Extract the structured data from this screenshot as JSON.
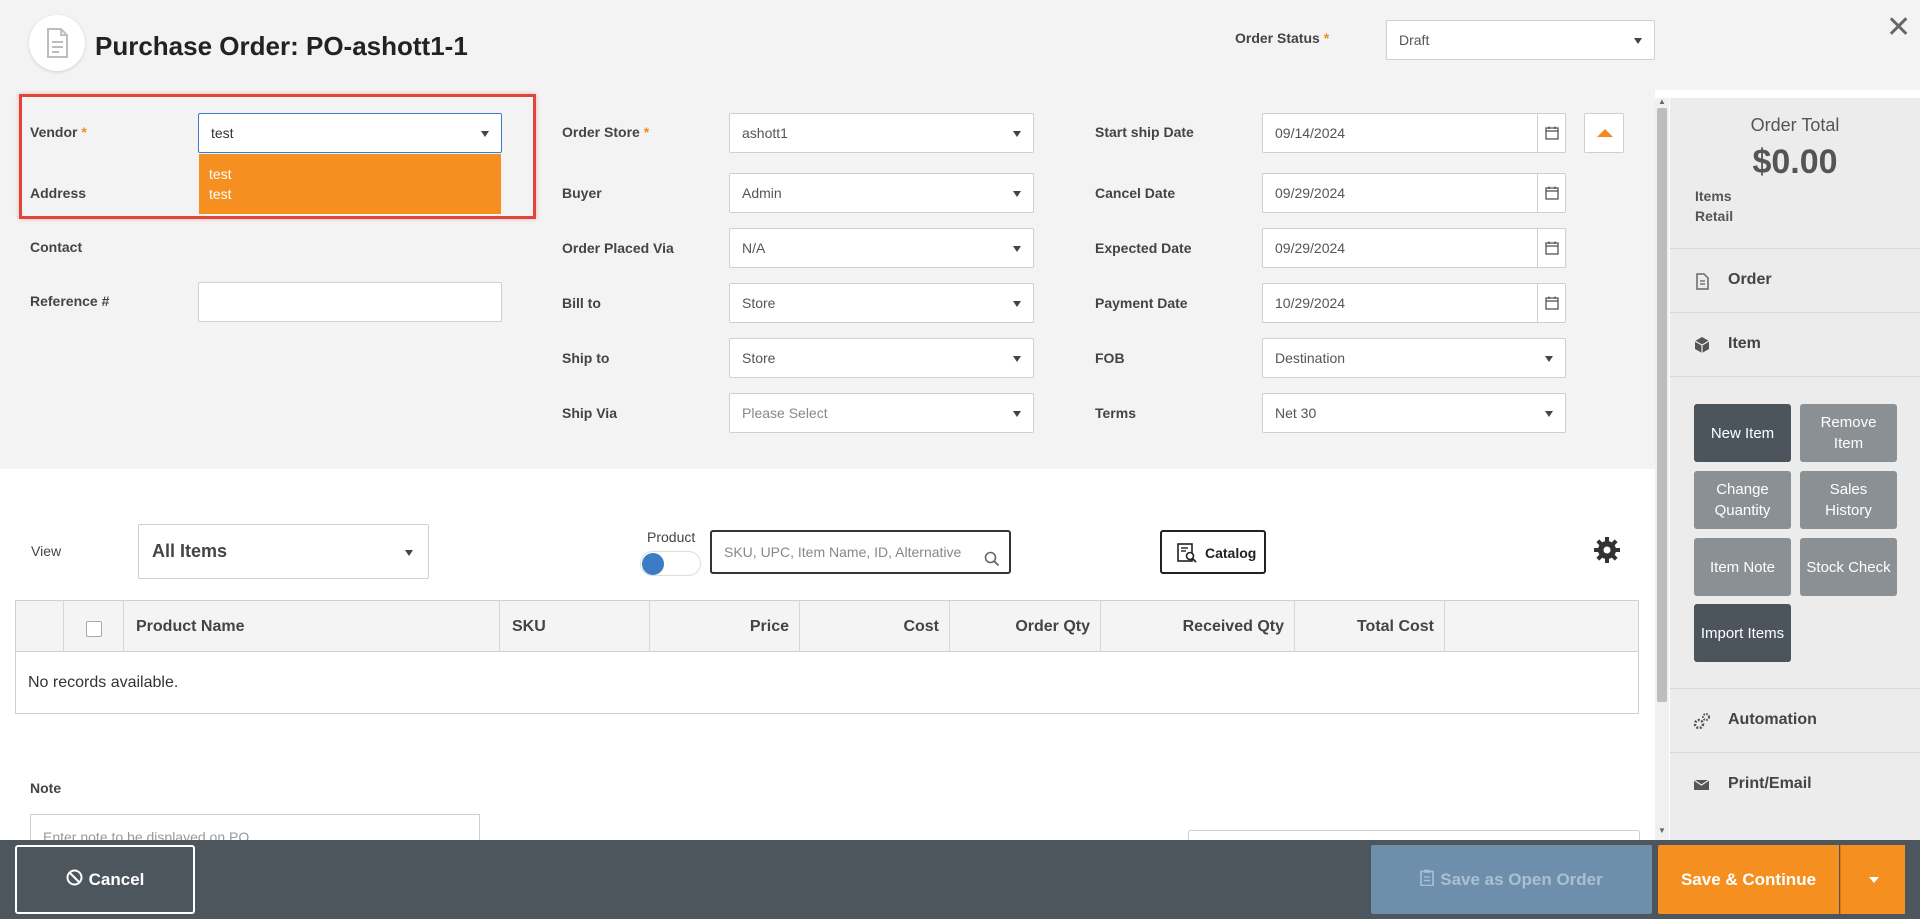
{
  "header": {
    "title": "Purchase Order: PO-ashott1-1",
    "order_status_label": "Order Status",
    "order_status_value": "Draft"
  },
  "vendor": {
    "label": "Vendor",
    "value": "test",
    "options": [
      "test",
      "test"
    ]
  },
  "left_fields": {
    "address_label": "Address",
    "contact_label": "Contact",
    "reference_label": "Reference #",
    "reference_value": ""
  },
  "middle_fields": {
    "order_store_label": "Order Store",
    "order_store_value": "ashott1",
    "buyer_label": "Buyer",
    "buyer_value": "Admin",
    "order_placed_via_label": "Order Placed Via",
    "order_placed_via_value": "N/A",
    "bill_to_label": "Bill to",
    "bill_to_value": "Store",
    "ship_to_label": "Ship to",
    "ship_to_value": "Store",
    "ship_via_label": "Ship Via",
    "ship_via_placeholder": "Please Select"
  },
  "right_fields": {
    "start_ship_label": "Start ship Date",
    "start_ship_value": "09/14/2024",
    "cancel_date_label": "Cancel Date",
    "cancel_date_value": "09/29/2024",
    "expected_date_label": "Expected Date",
    "expected_date_value": "09/29/2024",
    "payment_date_label": "Payment Date",
    "payment_date_value": "10/29/2024",
    "fob_label": "FOB",
    "fob_value": "Destination",
    "terms_label": "Terms",
    "terms_value": "Net 30"
  },
  "side_panel": {
    "order_total_label": "Order Total",
    "order_total_value": "$0.00",
    "items_label": "Items",
    "retail_label": "Retail",
    "nav": {
      "order": "Order",
      "item": "Item",
      "automation": "Automation",
      "print_email": "Print/Email"
    },
    "buttons": {
      "new_item": "New Item",
      "remove_item": "Remove Item",
      "change_quantity": "Change Quantity",
      "sales_history": "Sales History",
      "item_note": "Item Note",
      "stock_check": "Stock Check",
      "import_items": "Import Items"
    }
  },
  "toolbar": {
    "view_label": "View",
    "view_value": "All Items",
    "product_label": "Product",
    "search_placeholder": "SKU, UPC, Item Name, ID, Alternative",
    "catalog_label": "Catalog"
  },
  "grid": {
    "columns": [
      "Product Name",
      "SKU",
      "Price",
      "Cost",
      "Order Qty",
      "Received Qty",
      "Total Cost"
    ],
    "empty_message": "No records available."
  },
  "note": {
    "label": "Note",
    "placeholder": "Enter note to be displayed on PO"
  },
  "footer": {
    "cancel_label": "Cancel",
    "save_open_label": "Save as Open Order",
    "save_continue_label": "Save & Continue"
  },
  "colors": {
    "accent": "#f48f20",
    "footer_bg": "#4d555d",
    "highlight": "#e0453a",
    "toggle": "#3b7cc4"
  }
}
